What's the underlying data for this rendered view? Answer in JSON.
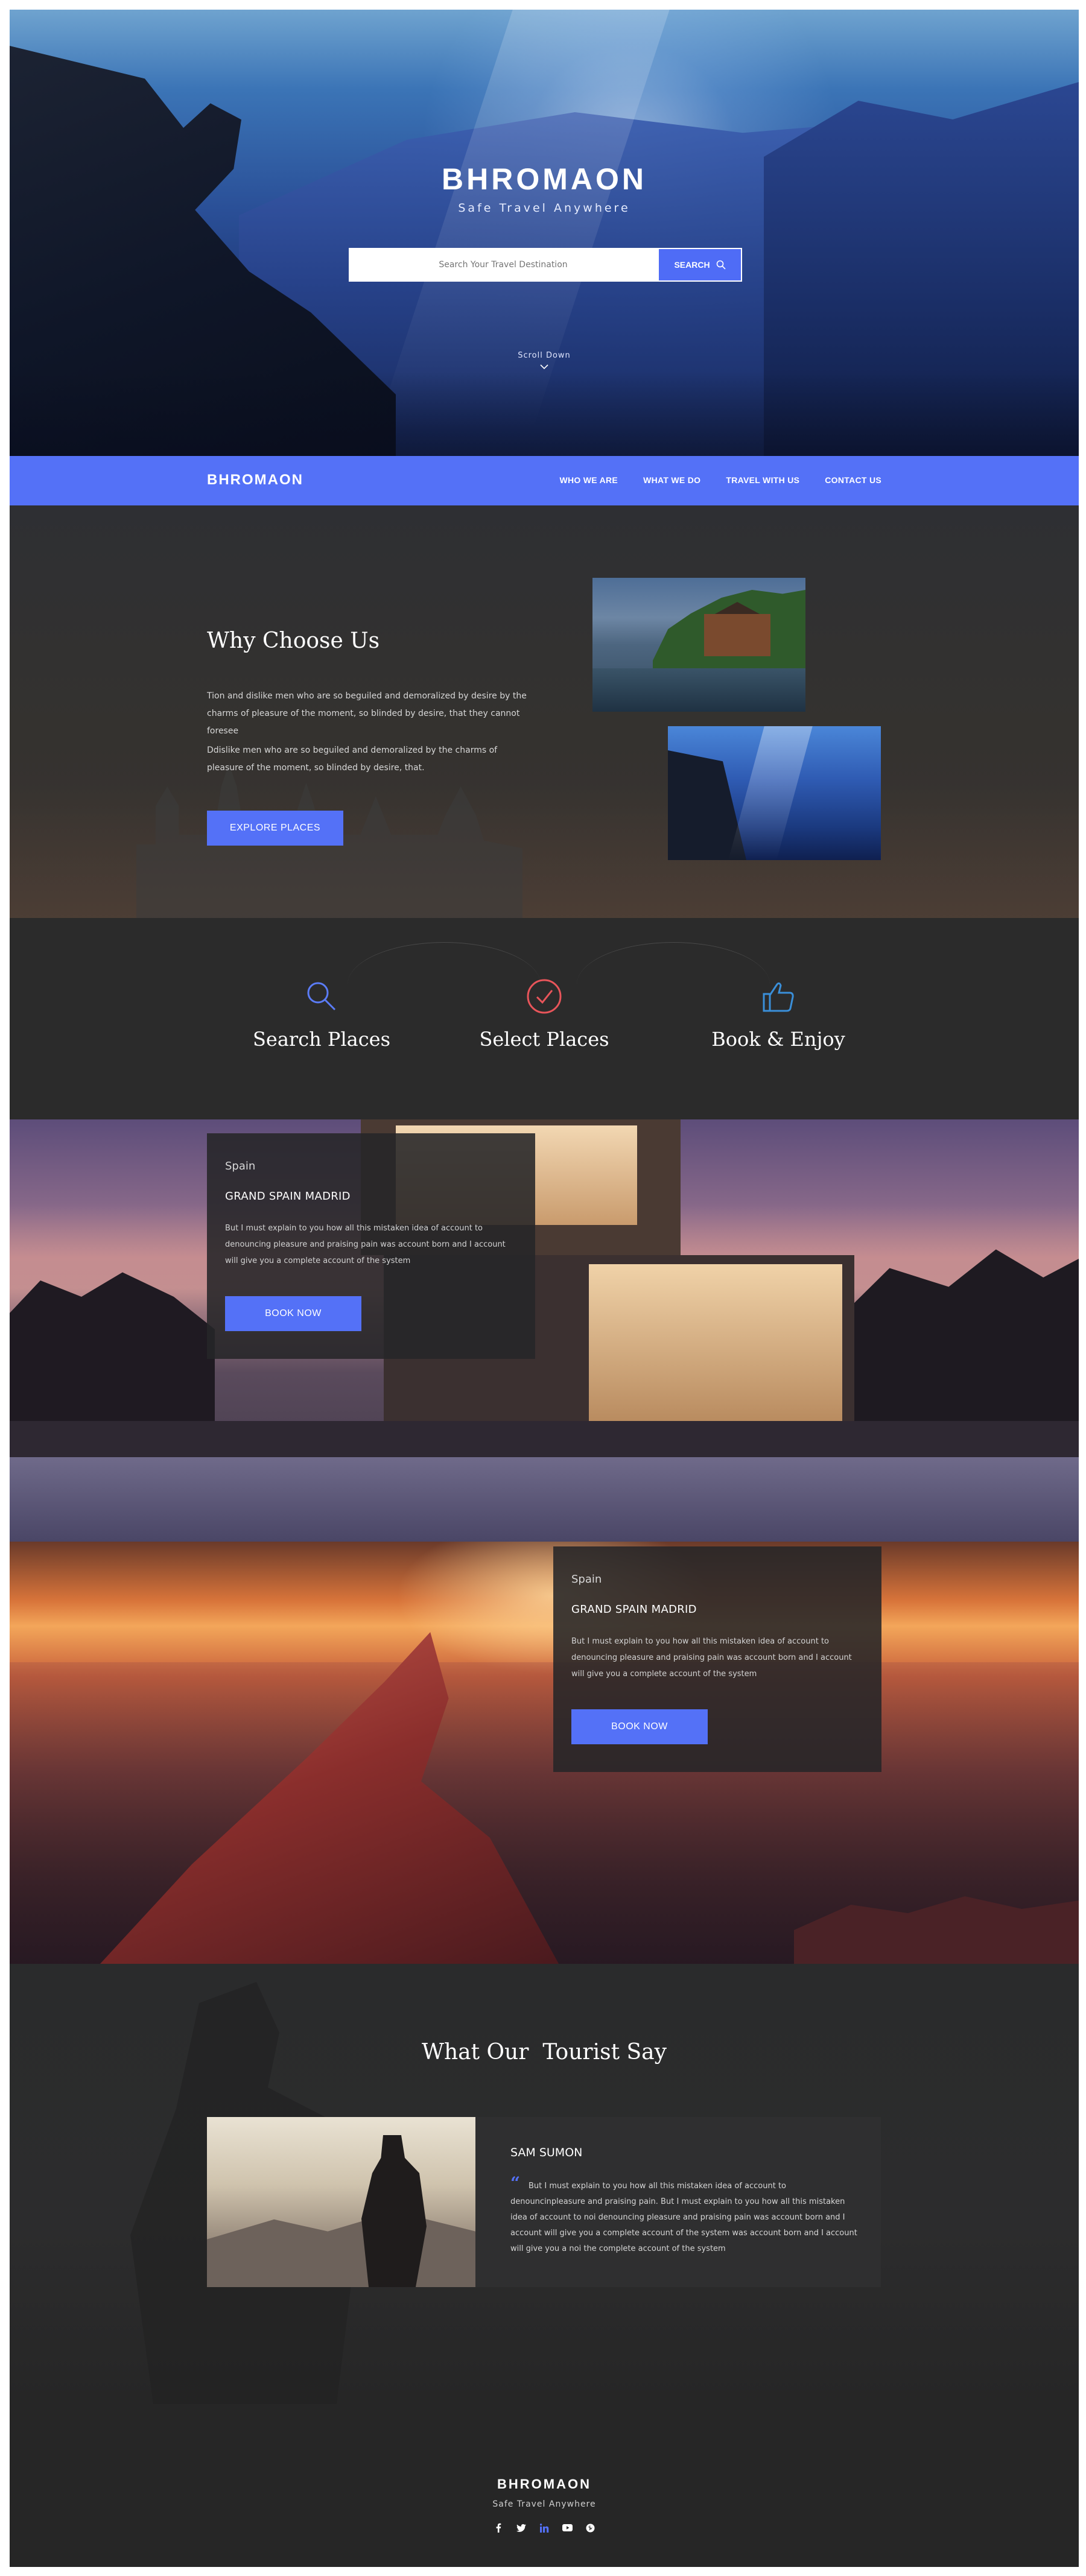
{
  "hero": {
    "brand": "BHROMAON",
    "tagline": "Safe Travel Anywhere",
    "search_placeholder": "Search Your Travel Destination",
    "search_button": "SEARCH",
    "scroll_label": "Scroll Down"
  },
  "nav": {
    "logo": "BHROMAON",
    "links": [
      "WHO WE ARE",
      "WHAT WE DO",
      "TRAVEL WITH US",
      "CONTACT US"
    ]
  },
  "why": {
    "title": "Why Choose Us",
    "paragraph1": "Tion and dislike men who are so beguiled and demoralized by desire by the charms of pleasure of the moment, so blinded by desire, that they cannot foresee",
    "paragraph2": "Ddislike men who are so beguiled and demoralized by the charms of pleasure of the moment, so blinded by desire, that.",
    "button": "EXPLORE PLACES"
  },
  "features": {
    "items": [
      {
        "label": "Search Places",
        "icon": "search-icon",
        "color": "#5b7cf7"
      },
      {
        "label": "Select Places",
        "icon": "check-circle-icon",
        "color": "#e8555a"
      },
      {
        "label": "Book & Enjoy",
        "icon": "thumbs-up-icon",
        "color": "#3a8fd9"
      }
    ]
  },
  "destinations": [
    {
      "country": "Spain",
      "title": "GRAND SPAIN MADRID",
      "description": "But I must explain to you how all this mistaken idea of account to denouncing pleasure and praising pain was account born and I account will give you a complete account of the system",
      "button": "BOOK NOW"
    },
    {
      "country": "Spain",
      "title": "GRAND SPAIN MADRID",
      "description": "But I must explain to you how all this mistaken idea of account to denouncing pleasure and praising pain was account born and I account will give you a complete account of the system",
      "button": "BOOK NOW"
    }
  ],
  "testimonial": {
    "title": "What Our  Tourist Say",
    "name": "SAM SUMON",
    "quote": "But I must explain to you how all this mistaken idea of account to denouncinpleasure and praising pain. But I must explain to you how all this mistaken idea of account to noi denouncing pleasure and praising pain was account born and I account will give you a complete account of the system was account born and I account will give you a noi the complete account of the system"
  },
  "footer": {
    "brand": "BHROMAON",
    "tagline": "Safe Travel Anywhere",
    "socials": [
      "facebook-icon",
      "twitter-icon",
      "linkedin-icon",
      "youtube-icon",
      "pinterest-icon"
    ],
    "linkedin_color": "#5471f7"
  },
  "colors": {
    "accent": "#5471f7",
    "dark_bg": "#262626"
  }
}
